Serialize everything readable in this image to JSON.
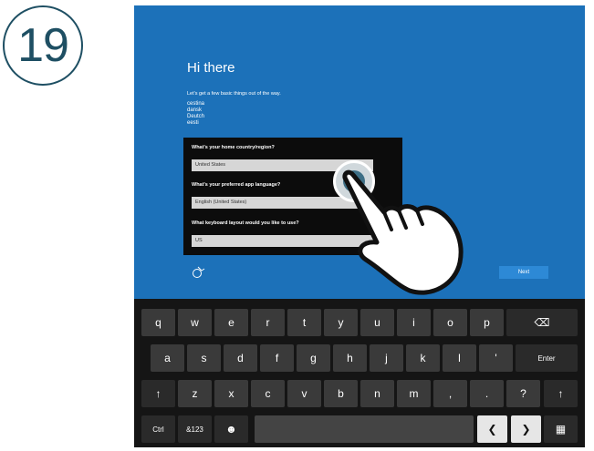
{
  "step_number": "19",
  "setup": {
    "title": "Hi there",
    "subtitle": "Let's get a few basic things out of the way.",
    "languages": [
      "cestina",
      "dansk",
      "Deutch",
      "eesti"
    ],
    "fields": [
      {
        "label": "What's your home country/region?",
        "value": "United States"
      },
      {
        "label": "What's your preferred app language?",
        "value": "English (United States)"
      },
      {
        "label": "What keyboard layout would you like to use?",
        "value": "US"
      }
    ],
    "next_label": "Next"
  },
  "keyboard": {
    "row1": [
      "q",
      "w",
      "e",
      "r",
      "t",
      "y",
      "u",
      "i",
      "o",
      "p"
    ],
    "row2": [
      "a",
      "s",
      "d",
      "f",
      "g",
      "h",
      "j",
      "k",
      "l",
      "'"
    ],
    "enter_label": "Enter",
    "row3": [
      "z",
      "x",
      "c",
      "v",
      "b",
      "n",
      "m",
      ",",
      ".",
      "?"
    ],
    "ctrl_label": "Ctrl",
    "symbols_label": "&123",
    "backspace_glyph": "⌫",
    "shift_glyph": "↑",
    "emoji_glyph": "☻",
    "left_glyph": "❮",
    "right_glyph": "❯",
    "keyboard_glyph": "▦"
  }
}
